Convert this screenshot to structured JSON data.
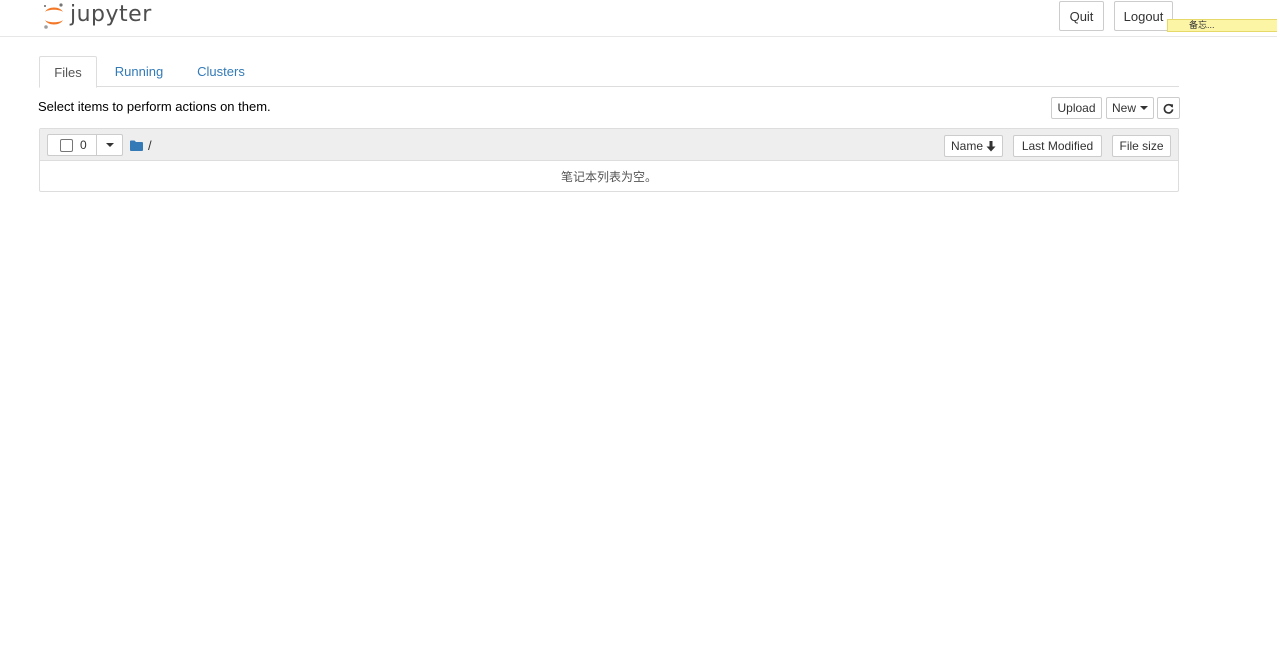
{
  "header": {
    "logo_text": "jupyter",
    "quit_label": "Quit",
    "logout_label": "Logout"
  },
  "memo": {
    "text": "备忘..."
  },
  "tabs": [
    {
      "label": "Files",
      "active": true
    },
    {
      "label": "Running",
      "active": false
    },
    {
      "label": "Clusters",
      "active": false
    }
  ],
  "toolbar": {
    "hint": "Select items to perform actions on them.",
    "upload_label": "Upload",
    "new_label": "New",
    "refresh_icon": "refresh-icon"
  },
  "list": {
    "selected_count": "0",
    "breadcrumb": "/",
    "columns": {
      "name": "Name",
      "last_modified": "Last Modified",
      "file_size": "File size"
    },
    "empty_message": "笔记本列表为空。"
  },
  "colors": {
    "link": "#337ab7",
    "logo_orange": "#f37726",
    "header_border": "#e7e7e7",
    "list_head_bg": "#eeeeee",
    "memo_bg": "#fdf5a6"
  }
}
